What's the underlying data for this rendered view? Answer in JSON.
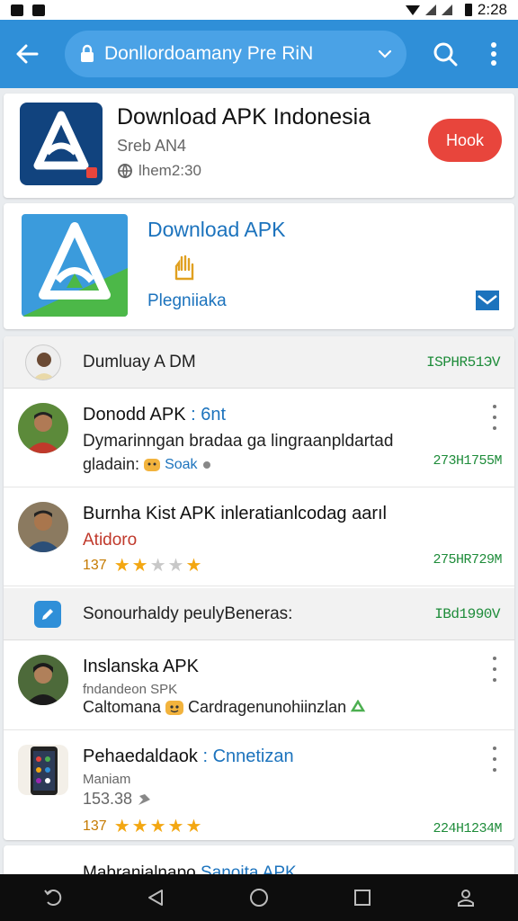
{
  "status_bar": {
    "time": "2:28"
  },
  "app_bar": {
    "url_text": "Donllordoamany  Pre RiN",
    "icons": [
      "back-arrow-icon",
      "lock-icon",
      "chevron-down-icon",
      "search-icon",
      "more-vert-icon"
    ]
  },
  "top_card": {
    "title": "Download APK Indonesia",
    "subtitle": "Sreb AN4",
    "meta": "lhem2:30",
    "action_label": "Hook"
  },
  "feature_card": {
    "title": "Download APK",
    "subtitle": "Plegniiaka"
  },
  "section1": {
    "label": "Dumluay A DM",
    "meta": "ISPHR51ЭV"
  },
  "rows": [
    {
      "name": "Donodd APK",
      "name_accent": ": 6nt",
      "line2": "Dymarinngan bradaa ga lingraanpldartad",
      "line3": "gladain:",
      "line3_tag": "Soak",
      "meta": "273H1755M"
    },
    {
      "name": "Burnha Kist APK inleratianlcodag aarıl",
      "line2": "Atidoro",
      "rating": "137",
      "stars": [
        1,
        1,
        0,
        0,
        1
      ],
      "meta": "275HR729M"
    }
  ],
  "section2": {
    "label": "Sonourhaldy peulyBeneras:",
    "meta": "IBd1990V"
  },
  "rows2": [
    {
      "name": "Inslanska APK",
      "line2": "fndandeon SPK",
      "line3": "Caltomana",
      "line3_tail": "Cardragenunohiinzlan"
    },
    {
      "name": "Pehaedaldaok",
      "name_accent": ": Cnnetizan",
      "line2": "Maniam",
      "line3": "153.38",
      "rating": "137",
      "stars": [
        1,
        1,
        1,
        1,
        1
      ],
      "meta": "224H1234M"
    }
  ],
  "bottom_row": {
    "name": "Mabranialnapo",
    "name_accent": "Sanoita APK"
  },
  "colors": {
    "primary": "#2f8fd8",
    "accent_red": "#e8453c",
    "meta_green": "#1e8c3a",
    "star": "#f3a712"
  },
  "nav_icons": [
    "recent-back-icon",
    "back-triangle-icon",
    "home-circle-icon",
    "recents-square-icon",
    "profile-icon"
  ]
}
